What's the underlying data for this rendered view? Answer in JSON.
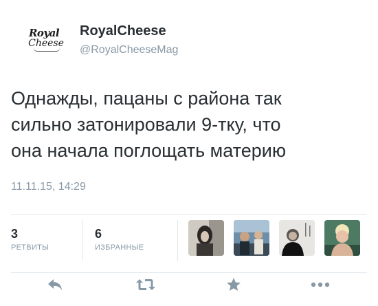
{
  "user": {
    "avatar_line1": "Royal",
    "avatar_line2": "Cheese",
    "name": "RoyalCheese",
    "handle": "@RoyalCheeseMag"
  },
  "tweet": {
    "lines": [
      "Однажды, пацаны с района так",
      "сильно затонировали 9-тку, что",
      "она начала поглощать материю"
    ],
    "timestamp": "11.11.15, 14:29"
  },
  "stats": {
    "retweets": {
      "count": "3",
      "label": "РЕТВИТЫ"
    },
    "favorites": {
      "count": "6",
      "label": "ИЗБРАННЫЕ"
    }
  },
  "faces": [
    "favoriter-avatar",
    "favoriter-avatar",
    "favoriter-avatar",
    "favoriter-avatar"
  ],
  "actions": [
    "reply-icon",
    "retweet-icon",
    "favorite-icon",
    "more-icon"
  ],
  "colors": {
    "text": "#292f33",
    "muted": "#8899a6",
    "divider": "#e1e8ed",
    "background": "#ffffff"
  }
}
